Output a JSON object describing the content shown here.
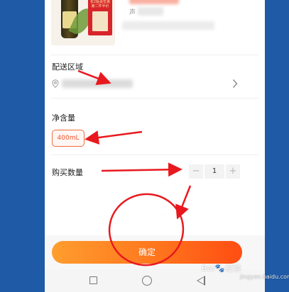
{
  "product": {
    "image_icon": "olive-oil-bottle-image",
    "promo_text": "买2瓶更优惠\n第二件半价",
    "spec_prefix": "声"
  },
  "delivery": {
    "title": "配送区域",
    "location_icon": "location-pin-icon",
    "chevron_icon": "chevron-right-icon"
  },
  "volume": {
    "title": "净含量",
    "options": [
      "400mL"
    ],
    "selected": "400mL"
  },
  "quantity": {
    "title": "购买数量",
    "minus": "−",
    "value": "1",
    "plus": "+"
  },
  "footer": {
    "confirm_label": "确定"
  },
  "nav": {
    "icons": [
      "recent-apps-icon",
      "home-icon",
      "back-icon"
    ]
  },
  "watermark": {
    "text": "Bai🐾经验",
    "sub": "jingyan.baidu.com"
  },
  "colors": {
    "accent": "#ff5a1f",
    "annotation": "#e8191e",
    "side_background": "#1f5aa6"
  }
}
